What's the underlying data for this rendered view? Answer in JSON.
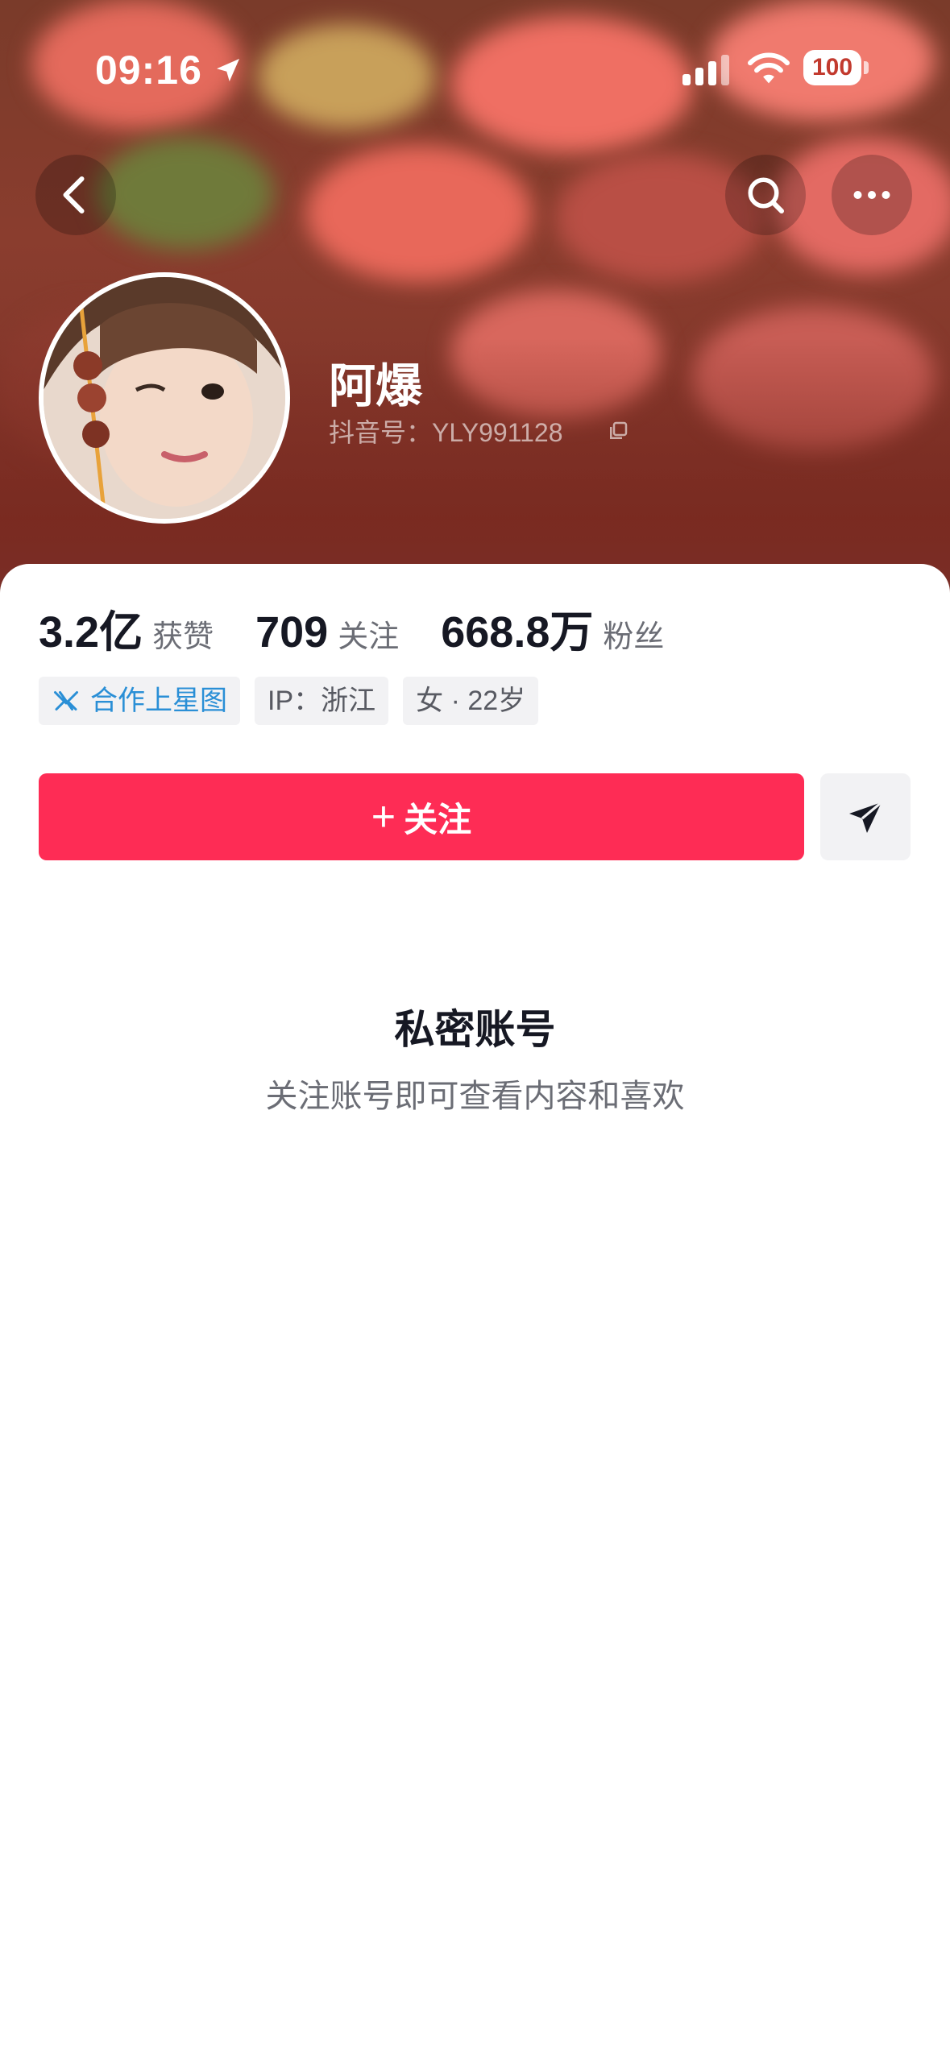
{
  "status_bar": {
    "time": "09:16",
    "battery": "100"
  },
  "profile": {
    "nickname": "阿爆",
    "douyin_id": "抖音号：YLY991128"
  },
  "stats": [
    {
      "value": "3.2亿",
      "label": "获赞"
    },
    {
      "value": "709",
      "label": "关注"
    },
    {
      "value": "668.8万",
      "label": "粉丝"
    }
  ],
  "tags": {
    "star": "合作上星图",
    "ip": "IP：浙江",
    "gender_age": "女 · 22岁"
  },
  "actions": {
    "follow_label": "关注",
    "follow_plus": "+"
  },
  "private": {
    "title": "私密账号",
    "desc": "关注账号即可查看内容和喜欢"
  },
  "colors": {
    "accent": "#fe2c55",
    "star_blue": "#2a8fd6"
  }
}
